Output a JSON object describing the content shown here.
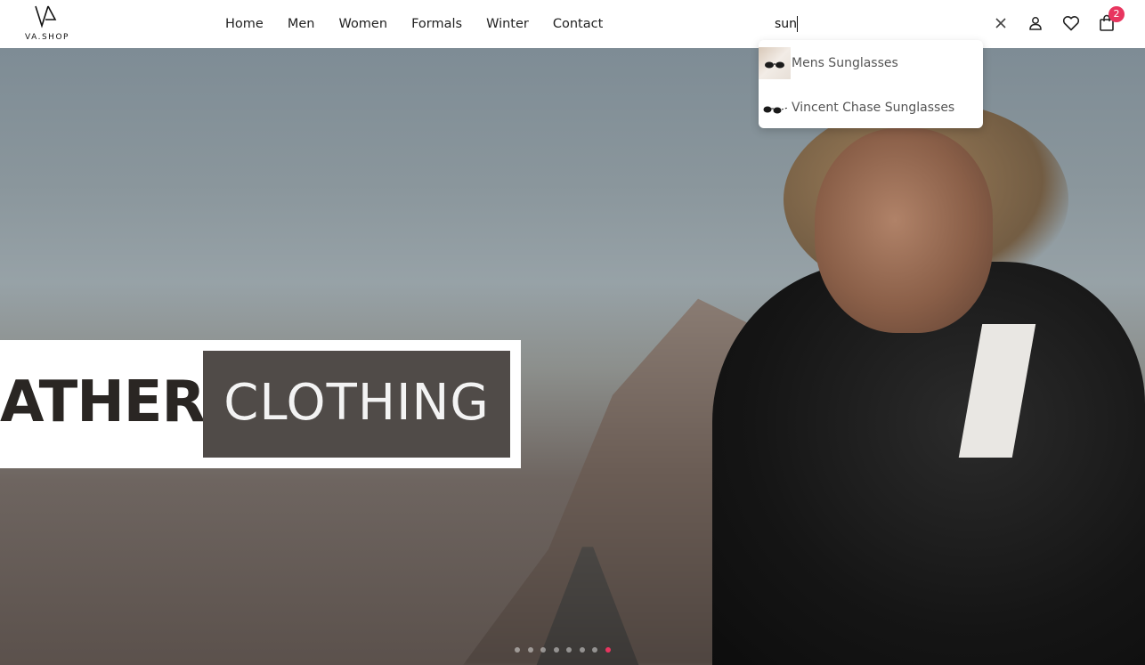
{
  "logo": {
    "text": "VA.SHOP"
  },
  "nav": {
    "items": [
      "Home",
      "Men",
      "Women",
      "Formals",
      "Winter",
      "Contact"
    ]
  },
  "search": {
    "value": "sun"
  },
  "cart": {
    "count": "2"
  },
  "suggestions": [
    {
      "label": "Mens Sunglasses"
    },
    {
      "label": "Vincent Chase Sunglasses"
    }
  ],
  "hero": {
    "left_text": "ATHER",
    "right_text": "CLOTHING"
  },
  "carousel": {
    "dot_count": 8,
    "active_index": 7
  },
  "colors": {
    "accent": "#e8355f"
  }
}
